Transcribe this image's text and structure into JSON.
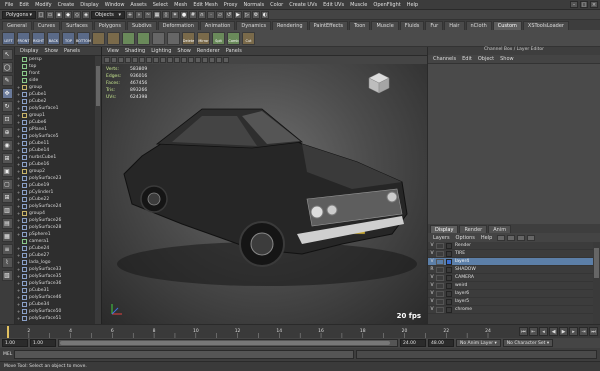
{
  "menubar": {
    "items": [
      "File",
      "Edit",
      "Modify",
      "Create",
      "Display",
      "Window",
      "Assets",
      "Select",
      "Mesh",
      "Edit Mesh",
      "Proxy",
      "Normals",
      "Color",
      "Create UVs",
      "Edit UVs",
      "Muscle",
      "OpenFlight",
      "Help"
    ]
  },
  "statusline": {
    "menu_set": "Polygons",
    "select_mode": "Objects"
  },
  "shelf": {
    "tabs": [
      "General",
      "Curves",
      "Surfaces",
      "Polygons",
      "Subdivs",
      "Deformation",
      "Animation",
      "Dynamics",
      "Rendering",
      "PaintEffects",
      "Toon",
      "Muscle",
      "Fluids",
      "Fur",
      "Hair",
      "nCloth",
      "Custom",
      "XSToolsLoader"
    ],
    "active_tab": "Custom",
    "buttons": [
      "LEFT",
      "FRONT",
      "RIGHT",
      "BACK",
      "TOP",
      "BOTTOM",
      "",
      "",
      "",
      "",
      "",
      "",
      "Delete",
      "Mirror",
      "Spit",
      "Comb",
      "Cut"
    ]
  },
  "outliner": {
    "menu": [
      "Display",
      "Show",
      "Panels"
    ],
    "items": [
      {
        "name": "persp",
        "kind": "cam"
      },
      {
        "name": "top",
        "kind": "cam"
      },
      {
        "name": "front",
        "kind": "cam"
      },
      {
        "name": "side",
        "kind": "cam"
      },
      {
        "name": "group",
        "kind": "grp"
      },
      {
        "name": "pCube1",
        "kind": "mesh"
      },
      {
        "name": "pCube2",
        "kind": "mesh"
      },
      {
        "name": "polySurface1",
        "kind": "mesh"
      },
      {
        "name": "group1",
        "kind": "grp"
      },
      {
        "name": "pCube6",
        "kind": "mesh"
      },
      {
        "name": "pPlane1",
        "kind": "mesh"
      },
      {
        "name": "polySurface5",
        "kind": "mesh"
      },
      {
        "name": "pCube11",
        "kind": "mesh"
      },
      {
        "name": "pCube14",
        "kind": "mesh"
      },
      {
        "name": "nurbsCube1",
        "kind": "mesh"
      },
      {
        "name": "pCube16",
        "kind": "mesh"
      },
      {
        "name": "group2",
        "kind": "grp"
      },
      {
        "name": "polySurface23",
        "kind": "mesh"
      },
      {
        "name": "pCube19",
        "kind": "mesh"
      },
      {
        "name": "pCylinder1",
        "kind": "mesh"
      },
      {
        "name": "pCube22",
        "kind": "mesh"
      },
      {
        "name": "polySurface24",
        "kind": "mesh"
      },
      {
        "name": "group4",
        "kind": "grp"
      },
      {
        "name": "polySurface26",
        "kind": "mesh"
      },
      {
        "name": "polySurface28",
        "kind": "mesh"
      },
      {
        "name": "pSphere1",
        "kind": "mesh"
      },
      {
        "name": "camera1",
        "kind": "cam"
      },
      {
        "name": "pCube24",
        "kind": "mesh"
      },
      {
        "name": "pCube27",
        "kind": "mesh"
      },
      {
        "name": "lada_logo",
        "kind": "mesh"
      },
      {
        "name": "polySurface33",
        "kind": "mesh"
      },
      {
        "name": "polySurface35",
        "kind": "mesh"
      },
      {
        "name": "polySurface36",
        "kind": "mesh"
      },
      {
        "name": "pCube31",
        "kind": "mesh"
      },
      {
        "name": "polySurface46",
        "kind": "mesh"
      },
      {
        "name": "pCube34",
        "kind": "mesh"
      },
      {
        "name": "polySurface50",
        "kind": "mesh"
      },
      {
        "name": "polySurface51",
        "kind": "mesh"
      }
    ]
  },
  "viewport": {
    "menu": [
      "View",
      "Shading",
      "Lighting",
      "Show",
      "Renderer",
      "Panels"
    ],
    "hud": [
      {
        "k": "Verts:",
        "v": "583809"
      },
      {
        "k": "Edges:",
        "v": "936016"
      },
      {
        "k": "Faces:",
        "v": "467456"
      },
      {
        "k": "Tris:",
        "v": "893266"
      },
      {
        "k": "UVs:",
        "v": "624398"
      }
    ],
    "fps": "20 fps"
  },
  "channelbox": {
    "title": "Channel Box / Layer Editor",
    "menu": [
      "Channels",
      "Edit",
      "Object",
      "Show"
    ],
    "layer_tabs": [
      "Display",
      "Render",
      "Anim"
    ],
    "active_layer_tab": "Display",
    "layer_menu": [
      "Layers",
      "Options",
      "Help"
    ],
    "layers": [
      {
        "v": "V",
        "name": "Render",
        "color": "#3a3a3a",
        "selected": false
      },
      {
        "v": "V",
        "name": "TIRE",
        "color": "#3a3a3a",
        "selected": false
      },
      {
        "v": "V",
        "name": "layer4",
        "color": "#3a6ed0",
        "selected": true
      },
      {
        "v": "R",
        "name": "SHADOW",
        "color": "#3a3a3a",
        "selected": false
      },
      {
        "v": "V",
        "name": "CAMERA",
        "color": "#3a3a3a",
        "selected": false
      },
      {
        "v": "V",
        "name": "weird",
        "color": "#3a3a3a",
        "selected": false
      },
      {
        "v": "V",
        "name": "layer6",
        "color": "#3a3a3a",
        "selected": false
      },
      {
        "v": "V",
        "name": "layer5",
        "color": "#3a3a3a",
        "selected": false
      },
      {
        "v": "V",
        "name": "chrome",
        "color": "#3a3a3a",
        "selected": false
      }
    ]
  },
  "timeline": {
    "ticks": [
      "1",
      "2",
      "4",
      "6",
      "8",
      "10",
      "12",
      "14",
      "16",
      "18",
      "20",
      "22",
      "24"
    ],
    "current": "1.00"
  },
  "rangebar": {
    "start": "1.00",
    "current": "1.00",
    "end_a": "24.00",
    "end_b": "48.00",
    "anim_layer": "No Anim Layer",
    "char_set": "No Character Set"
  },
  "cmdline": {
    "label": "MEL"
  },
  "helpline": {
    "text": "Move Tool: Select an object to move."
  }
}
